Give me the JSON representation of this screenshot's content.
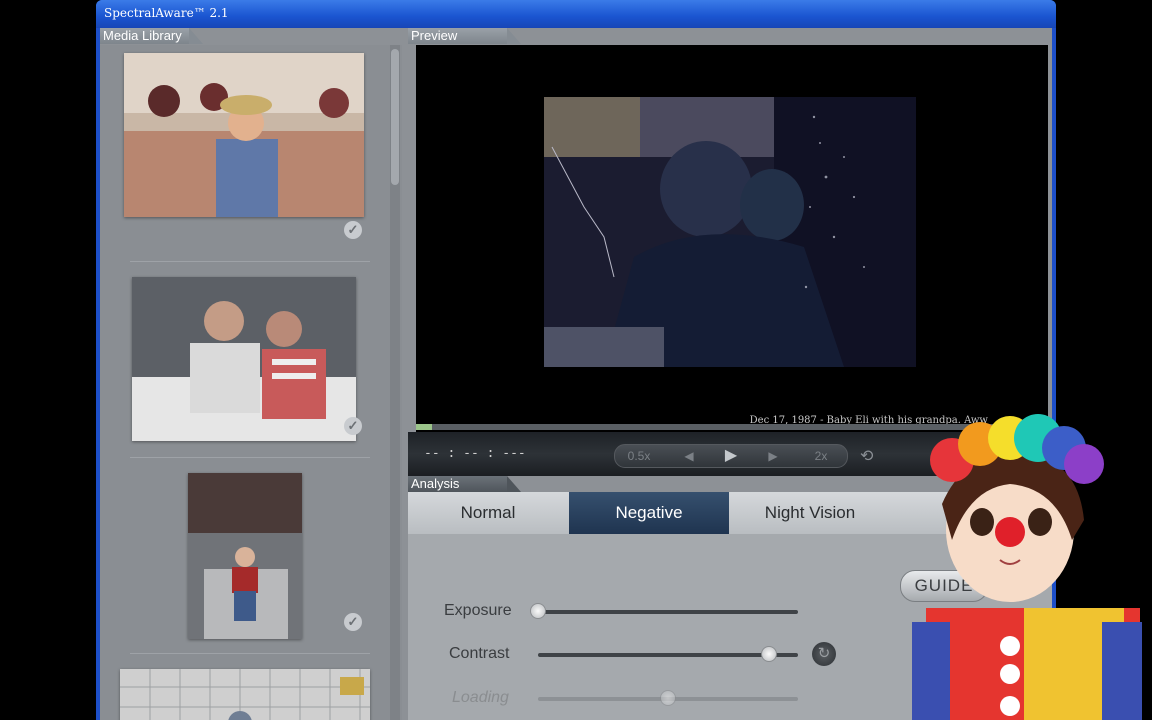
{
  "app": {
    "title": "SpectralAware™ 2.1"
  },
  "panels": {
    "media_library": "Media Library",
    "preview": "Preview",
    "analysis": "Analysis"
  },
  "library": {
    "items": [
      {
        "checked": true
      },
      {
        "checked": true
      },
      {
        "checked": true
      },
      {
        "checked": false
      }
    ]
  },
  "preview": {
    "caption": "Dec 17, 1987 - Baby Eli with his grandpa. Aww"
  },
  "transport": {
    "timecode": "-- : -- : ---",
    "slow_label": "0.5x",
    "fast_label": "2x",
    "prev_icon": "step-back-icon",
    "play_icon": "play-icon",
    "next_icon": "step-forward-icon",
    "loop_icon": "loop-icon"
  },
  "analysis": {
    "tabs": [
      "Normal",
      "Negative",
      "Night Vision"
    ],
    "active_tab": "Negative",
    "sliders": [
      {
        "label": "Exposure",
        "value": 0.0
      },
      {
        "label": "Contrast",
        "value": 0.89
      },
      {
        "label": "Loading",
        "value": 0.5
      }
    ],
    "guide_label": "GUIDE"
  },
  "colors": {
    "titlebar": "#1a54d0",
    "active_tab": "#1f3450",
    "panel_bg": "#8d9196"
  }
}
